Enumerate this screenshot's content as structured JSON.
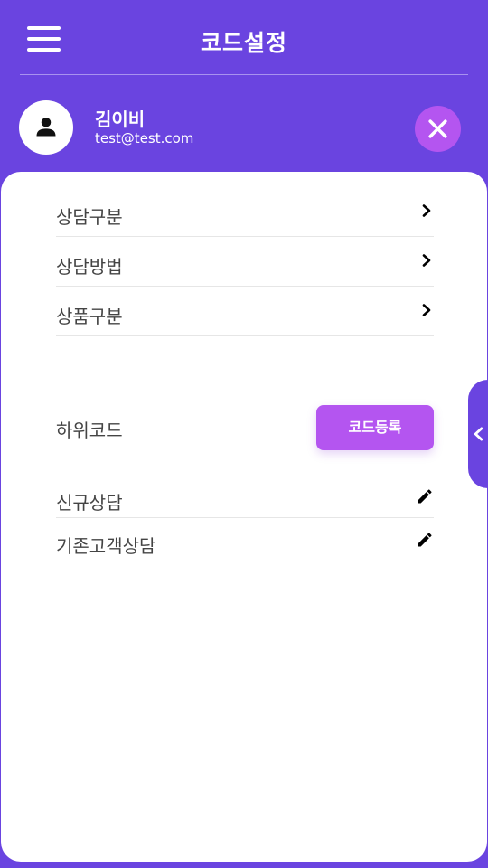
{
  "header": {
    "title": "코드설정"
  },
  "user": {
    "name": "김이비",
    "email": "test@test.com"
  },
  "menu": {
    "items": [
      {
        "label": "상담구분"
      },
      {
        "label": "상담방법"
      },
      {
        "label": "상품구분"
      }
    ]
  },
  "subcode": {
    "label": "하위코드",
    "register_label": "코드등록",
    "items": [
      {
        "label": "신규상담"
      },
      {
        "label": "기존고객상담"
      }
    ]
  },
  "colors": {
    "primary": "#6a44e0",
    "accent": "#b455f0"
  },
  "icons": {
    "menu": "hamburger-icon",
    "avatar": "person-icon",
    "close": "close-icon",
    "row": "chevron-right-icon",
    "edit": "pencil-icon",
    "tab": "chevron-left-icon"
  }
}
